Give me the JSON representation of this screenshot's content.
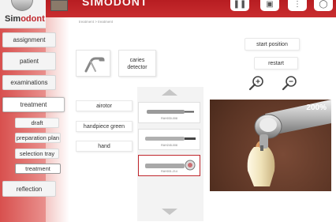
{
  "app": {
    "logo_prefix": "Sim",
    "logo_suffix": "odont",
    "title": "SIMODONT"
  },
  "topbar": {
    "icons": [
      "pause-icon",
      "camera-icon",
      "more-icon",
      "power-icon"
    ]
  },
  "breadcrumb": "treatment > treatment",
  "sidebar": {
    "items": [
      {
        "label": "assignment",
        "active": false
      },
      {
        "label": "patient",
        "active": false
      },
      {
        "label": "examinations",
        "active": false
      },
      {
        "label": "treatment",
        "active": true
      },
      {
        "label": "reflection",
        "active": false
      }
    ],
    "subitems": [
      {
        "label": "draft",
        "active": false
      },
      {
        "label": "preparation plan",
        "active": false
      },
      {
        "label": "selection tray",
        "active": false
      },
      {
        "label": "treatment",
        "active": true
      }
    ]
  },
  "tools": {
    "caries_detector_line1": "caries",
    "caries_detector_line2": "detector"
  },
  "controls": {
    "start_position": "start position",
    "restart": "restart",
    "zoom_in": "zoom-in-icon",
    "zoom_out": "zoom-out-icon"
  },
  "handpieces": {
    "buttons": [
      "airotor",
      "handpiece green",
      "hand"
    ],
    "list": [
      {
        "code": "RAH030-008",
        "selected": false
      },
      {
        "code": "RAH245-008",
        "selected": false
      },
      {
        "code": "RAH001-214",
        "selected": true
      }
    ]
  },
  "view": {
    "zoom": "200%"
  },
  "colors": {
    "brand_red": "#c0272d",
    "sidebar_red": "#d8504e",
    "view_background": "#6a3e2c"
  }
}
